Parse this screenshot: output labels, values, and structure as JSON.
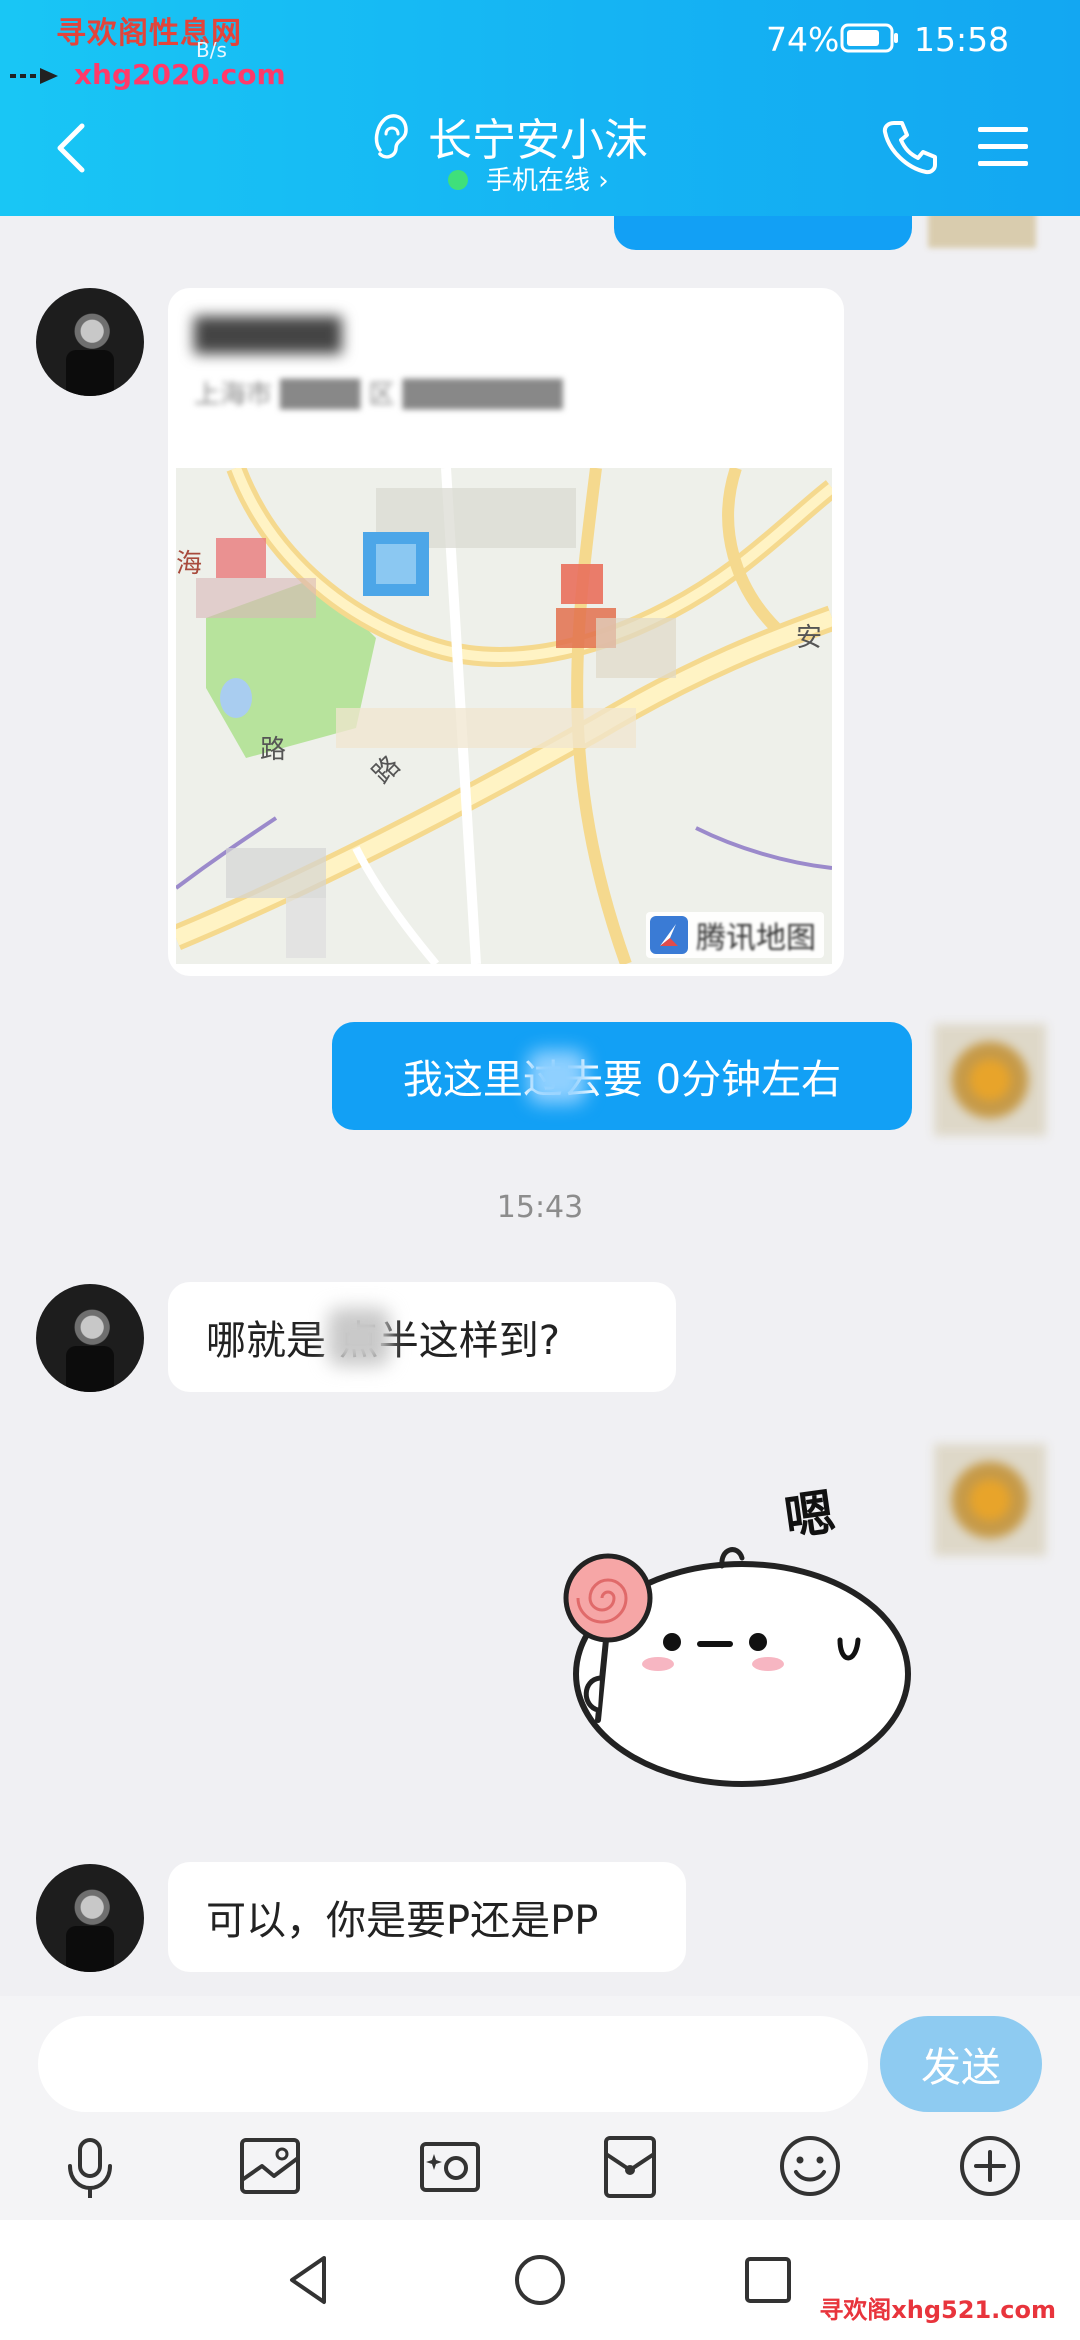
{
  "status_bar": {
    "watermark_title": "寻欢阁性息网",
    "watermark_site": "xhg2020.com",
    "net_speed": "B/s",
    "battery": "74%",
    "time": "15:58"
  },
  "header": {
    "contact_name": "长宁安小沫",
    "online_status": "手机在线 ›"
  },
  "messages": {
    "location_name": "██████",
    "location_address": "上海市 ████ 区 ████████",
    "map_label_1": "海",
    "map_label_2": "安",
    "map_label_3": "路",
    "map_label_4": "路",
    "map_provider": "腾讯地图",
    "outgoing_1": "我这里过去要  0分钟左右",
    "time_divider": "15:43",
    "incoming_1": "哪就是  点半这样到?",
    "incoming_2": "可以，你是要P还是PP"
  },
  "input": {
    "placeholder": "",
    "send_label": "发送"
  },
  "footer": {
    "watermark": "寻欢阁xhg521.com"
  },
  "colors": {
    "header_start": "#19c6f5",
    "header_end": "#13a7f2",
    "bubble_out": "#12a0f5",
    "send_button": "#8ecbf1",
    "online_dot": "#3fe07b"
  },
  "icons": [
    "back-icon",
    "ear-icon",
    "phone-icon",
    "menu-icon",
    "battery-icon",
    "mic-icon",
    "image-icon",
    "camera-icon",
    "red-packet-icon",
    "emoji-icon",
    "plus-icon",
    "nav-back-icon",
    "nav-home-icon",
    "nav-recents-icon"
  ]
}
